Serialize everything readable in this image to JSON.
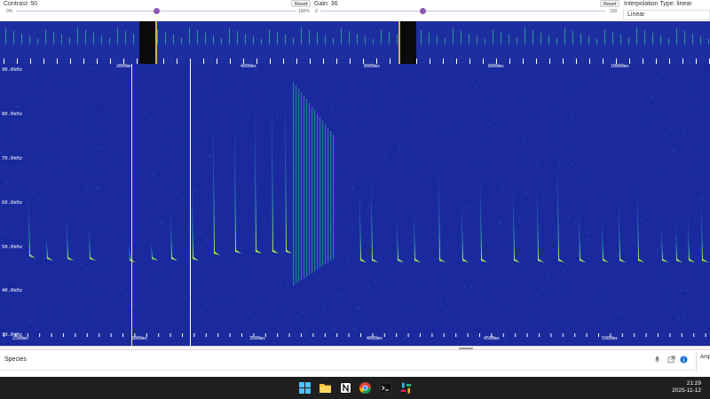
{
  "controls": {
    "contrast_label": "Contrast: 50",
    "contrast_value": 50,
    "contrast_min": "0%",
    "contrast_max": "100%",
    "gain_label": "Gain: 36",
    "gain_value": 36,
    "gain_min": "0",
    "gain_max": "100",
    "reset_label": "Reset",
    "interpolation_label": "Interpolation Type: linear",
    "interpolation_value": "Linear"
  },
  "overview": {
    "time_ticks": [
      "2000ms",
      "4000ms",
      "6000ms",
      "8000ms",
      "10000ms"
    ]
  },
  "spectrogram": {
    "freq_labels": [
      "90.0kHz",
      "80.0kHz",
      "70.0kHz",
      "60.0kHz",
      "50.0kHz",
      "40.0kHz",
      "30.0kHz"
    ],
    "top_time_labels": [
      "2000ms",
      "4000ms",
      "6000ms",
      "8000ms",
      "10000ms"
    ],
    "bottom_time_labels": [
      "2500ms",
      "3000ms",
      "3500ms",
      "4000ms",
      "4500ms",
      "5000ms"
    ],
    "colors": {
      "background": "#1a2a9e",
      "call": "#3fe07a",
      "call_peak": "#c8f542"
    }
  },
  "species_panel": {
    "title": "Species",
    "icons": [
      "microphone-icon",
      "external-link-icon",
      "info-icon"
    ]
  },
  "side_tab": {
    "label": "Amp"
  },
  "taskbar": {
    "apps": [
      "windows-start-icon",
      "file-explorer-icon",
      "notion-icon",
      "chrome-icon",
      "terminal-icon",
      "slack-icon"
    ],
    "time": "21:29",
    "date": "2025-11-12"
  }
}
